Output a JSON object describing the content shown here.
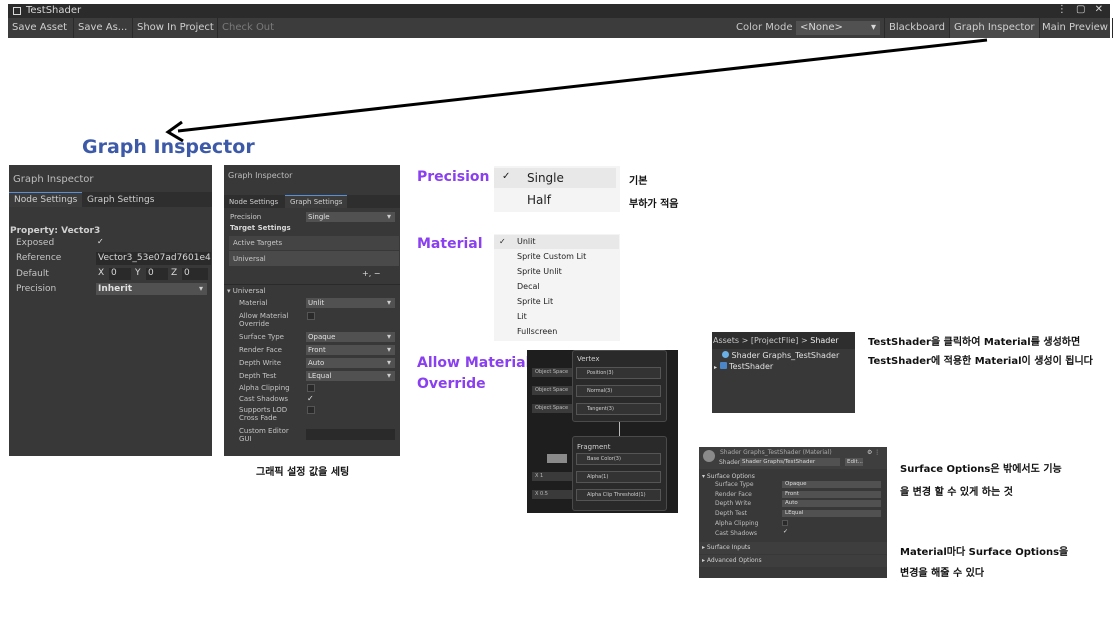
{
  "window": {
    "title": "TestShader",
    "controls": "⋮ ▢ ✕"
  },
  "toolbar": {
    "save_asset": "Save Asset",
    "save_as": "Save As...",
    "show_in_project": "Show In Project",
    "check_out": "Check Out",
    "color_mode_label": "Color Mode",
    "color_mode_value": "<None>",
    "blackboard": "Blackboard",
    "graph_inspector": "Graph Inspector",
    "main_preview": "Main Preview"
  },
  "annotations": {
    "graph_inspector_heading": "Graph Inspector",
    "precision": "Precision",
    "material": "Material",
    "allow_material_override": "Allow Material\nOverride",
    "precision_note_single": "기본",
    "precision_note_half": "부하가 적음",
    "graph_settings_caption": "그래픽 설정 값을 세팅",
    "project_note_1": "TestShader을 클릭하여 Material를 생성하면",
    "project_note_2": "TestShader에 적용한 Material이 생성이 됩니다",
    "surface_note_1": "Surface Options은 밖에서도 기능",
    "surface_note_2": "을 변경 할 수 있게 하는 것",
    "surface_note_3": "Material마다 Surface Options을",
    "surface_note_4": "변경을 해줄 수 있다"
  },
  "inspector_node": {
    "title": "Graph Inspector",
    "tabs": [
      "Node Settings",
      "Graph Settings"
    ],
    "property_header": "Property: Vector3",
    "exposed_label": "Exposed",
    "reference_label": "Reference",
    "reference_value": "Vector3_53e07ad7601e4",
    "default_label": "Default",
    "default_x_label": "X",
    "default_x": "0",
    "default_y_label": "Y",
    "default_y": "0",
    "default_z_label": "Z",
    "default_z": "0",
    "precision_label": "Precision",
    "precision_value": "Inherit"
  },
  "inspector_graph": {
    "title": "Graph Inspector",
    "tabs": [
      "Node Settings",
      "Graph Settings"
    ],
    "precision_label": "Precision",
    "precision_value": "Single",
    "target_settings": "Target Settings",
    "active_targets": "Active Targets",
    "universal_item": "Universal",
    "add_remove": "+,  −",
    "universal_section": "Universal",
    "rows": [
      {
        "label": "Material",
        "value": "Unlit",
        "kind": "dropdown"
      },
      {
        "label": "Allow Material\nOverride",
        "value": "",
        "kind": "checkbox"
      },
      {
        "label": "Surface Type",
        "value": "Opaque",
        "kind": "dropdown"
      },
      {
        "label": "Render Face",
        "value": "Front",
        "kind": "dropdown"
      },
      {
        "label": "Depth Write",
        "value": "Auto",
        "kind": "dropdown"
      },
      {
        "label": "Depth Test",
        "value": "LEqual",
        "kind": "dropdown"
      },
      {
        "label": "Alpha Clipping",
        "value": "",
        "kind": "checkbox"
      },
      {
        "label": "Cast Shadows",
        "value": "✓",
        "kind": "checkbox"
      },
      {
        "label": "Supports LOD\nCross Fade",
        "value": "",
        "kind": "checkbox"
      },
      {
        "label": "Custom Editor\nGUI",
        "value": "",
        "kind": "field"
      }
    ]
  },
  "precision_menu": {
    "checked": "✓",
    "items": [
      "Single",
      "Half"
    ]
  },
  "material_menu": {
    "checked": "✓",
    "items": [
      "Unlit",
      "Sprite Custom Lit",
      "Sprite Unlit",
      "Decal",
      "Sprite Lit",
      "Lit",
      "Fullscreen"
    ]
  },
  "node_graph": {
    "vertex_title": "Vertex",
    "vertex_rows": [
      {
        "input": "Object Space",
        "port": "Position(3)"
      },
      {
        "input": "Object Space",
        "port": "Normal(3)"
      },
      {
        "input": "Object Space",
        "port": "Tangent(3)"
      }
    ],
    "fragment_title": "Fragment",
    "fragment_rows": [
      {
        "input": "",
        "port": "Base Color(3)"
      },
      {
        "input": "X  1",
        "port": "Alpha(1)"
      },
      {
        "input": "X  0.5",
        "port": "Alpha Clip Threshold(1)"
      }
    ]
  },
  "project": {
    "breadcrumb": [
      "Assets",
      "[ProjectFlie]",
      "Shader"
    ],
    "items": [
      "Shader Graphs_TestShader",
      "TestShader"
    ]
  },
  "material_inspector": {
    "title": "Shader Graphs_TestShader (Material)",
    "shader_label": "Shader",
    "shader_value": "Shader Graphs/TestShader",
    "edit_button": "Edit...",
    "surface_options": "Surface Options",
    "rows": [
      {
        "label": "Surface Type",
        "value": "Opaque"
      },
      {
        "label": "Render Face",
        "value": "Front"
      },
      {
        "label": "Depth Write",
        "value": "Auto"
      },
      {
        "label": "Depth Test",
        "value": "LEqual"
      }
    ],
    "alpha_clipping": "Alpha Clipping",
    "cast_shadows": "Cast Shadows",
    "cast_shadows_value": "✓",
    "surface_inputs": "Surface Inputs",
    "advanced_options": "Advanced Options"
  }
}
